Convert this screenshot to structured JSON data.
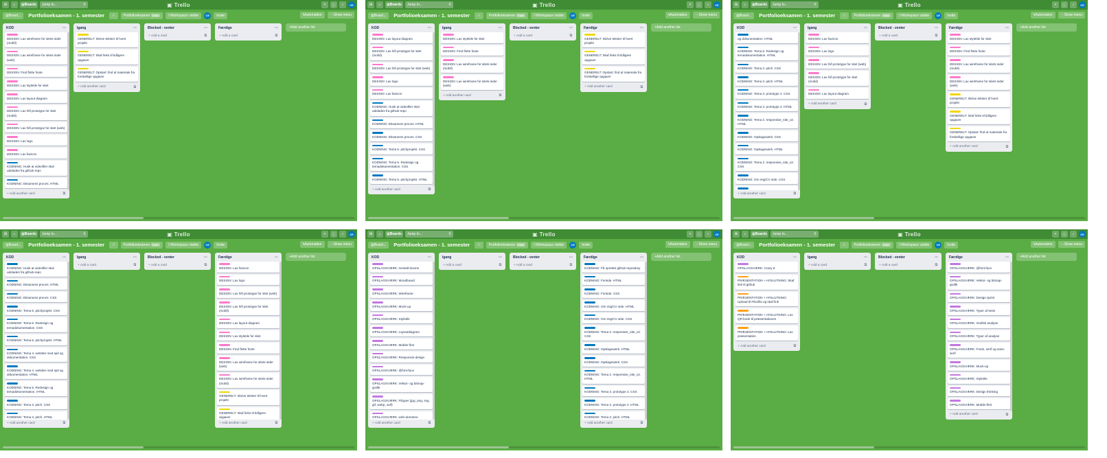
{
  "topbar": {
    "boards_label": "Boards",
    "search_placeholder": "Jump to...",
    "logo": "Trello",
    "avatar_initials": "CE"
  },
  "boardbar": {
    "view_label": "Board",
    "title": "Portfolioeksamen - 1. semester",
    "workspace_label": "Portfolioeksamen",
    "free_badge": "Free",
    "visibility_label": "Workspace visible",
    "invite_label": "Invite",
    "automation_label": "Automation",
    "show_menu_label": "Show menu"
  },
  "common": {
    "add_card": "Add another card",
    "add_card_short": "Add a card",
    "add_list": "Add another list",
    "list_menu": "···"
  },
  "colors": {
    "board_bg": "#5aac44",
    "topbar_bg": "#3f8c34",
    "DESIGN": "#ff78cb",
    "KODNING": "#0079bf",
    "GENERELT": "#f2d600",
    "OPSLAGSVÆRK": "#c377e0",
    "PRÆSENTATION": "#ff9f1a"
  },
  "screenshots": [
    {
      "lists": [
        {
          "title": "KOD",
          "has_scroll": true,
          "cards": [
            {
              "label": "DESIGN",
              "text": "DESIGN: Lav wireframe for sitets sider (mobil)"
            },
            {
              "label": "DESIGN",
              "text": "DESIGN: Lav wireframe for sitets sider (web)"
            },
            {
              "label": "DESIGN",
              "text": "DESIGN: Find flotte fonte"
            },
            {
              "label": "DESIGN",
              "text": "DESIGN: Lav styletile for sitet"
            },
            {
              "label": "DESIGN",
              "text": "DESIGN: Lav layout diagram"
            },
            {
              "label": "DESIGN",
              "text": "DESIGN: Lav hifi prototype for sitet (mobil)"
            },
            {
              "label": "DESIGN",
              "text": "DESIGN: Lav hifi prototype for sitet (web)"
            },
            {
              "label": "DESIGN",
              "text": "DESIGN: Lav logo"
            },
            {
              "label": "DESIGN",
              "text": "DESIGN: Lav favicon"
            },
            {
              "label": "KODNING",
              "text": "KODNING: Husk at videofiler skal udelades fra github-repo"
            },
            {
              "label": "KODNING",
              "text": "KODNING: Eksamens proces. HTML"
            }
          ],
          "add": "add_card"
        },
        {
          "title": "Igang",
          "cards": [
            {
              "label": "GENERELT",
              "text": "GENERELT: Skrive tekster til hvert projekt"
            },
            {
              "label": "GENERELT",
              "text": "GENERELT: Skaf links til tidligere opgaver"
            },
            {
              "label": "GENERELT",
              "text": "GENERELT: Opstart: find al materiale fra forskellige opgaver"
            }
          ],
          "add": "add_card"
        },
        {
          "title": "Blocked - venter",
          "cards": [],
          "add": "add_card_short"
        },
        {
          "title": "Færdige",
          "cards": [],
          "add": "add_card_short"
        }
      ]
    },
    {
      "lists": [
        {
          "title": "KOD",
          "has_scroll": true,
          "cards": [
            {
              "label": "DESIGN",
              "text": "DESIGN: Lav layout diagram"
            },
            {
              "label": "DESIGN",
              "text": "DESIGN: Lav hifi prototype for sitet (mobil)"
            },
            {
              "label": "DESIGN",
              "text": "DESIGN: Lav hifi prototype for sitet (web)"
            },
            {
              "label": "DESIGN",
              "text": "DESIGN: Lav logo"
            },
            {
              "label": "DESIGN",
              "text": "DESIGN: Lav favicon"
            },
            {
              "label": "KODNING",
              "text": "KODNING: Husk at videofiler skal udelades fra github-repo"
            },
            {
              "label": "KODNING",
              "text": "KODNING: Eksamens proces. HTML"
            },
            {
              "label": "KODNING",
              "text": "KODNING: Eksamens proces. CSS"
            },
            {
              "label": "KODNING",
              "text": "KODNING: Tema 5. pitchprojekt. CSS"
            },
            {
              "label": "KODNING",
              "text": "KODNING: Tema 5. Redesign og temadokumentation. CSS"
            },
            {
              "label": "KODNING",
              "text": "KODNING: Tema 5. pitchprojekt. HTML"
            }
          ],
          "add": "add_card"
        },
        {
          "title": "Igang",
          "cards": [
            {
              "label": "DESIGN",
              "text": "DESIGN: Lav styletile for sitet"
            },
            {
              "label": "DESIGN",
              "text": "DESIGN: Find flotte fonte"
            },
            {
              "label": "DESIGN",
              "text": "DESIGN: Lav wireframe for sitets sider (mobil)"
            },
            {
              "label": "DESIGN",
              "text": "DESIGN: Lav wireframe for sitets sider (web)"
            }
          ],
          "add": "add_card"
        },
        {
          "title": "Blocked - venter",
          "cards": [],
          "add": "add_card_short"
        },
        {
          "title": "Færdige",
          "cards": [
            {
              "label": "GENERELT",
              "text": "GENERELT: Skrive tekster til hvert projekt"
            },
            {
              "label": "GENERELT",
              "text": "GENERELT: Skaf links til tidligere opgaver"
            },
            {
              "label": "GENERELT",
              "text": "GENERELT: Opstart: find al materiale fra forskellige opgaver"
            }
          ],
          "add": "add_card"
        }
      ]
    },
    {
      "lists": [
        {
          "title": "KOD",
          "has_scroll": true,
          "cards": [
            {
              "label": "KODNING",
              "text": "og dokumentation. HTML"
            },
            {
              "label": "KODNING",
              "text": "KODNING: Tema 5. Redesign og temadokumentation. HTML"
            },
            {
              "label": "KODNING",
              "text": "KODNING: Tema 3. pitch. CSS"
            },
            {
              "label": "KODNING",
              "text": "KODNING: Tema 3. pitch. HTML"
            },
            {
              "label": "KODNING",
              "text": "KODNING: Tema 3. prototype 2. CSS"
            },
            {
              "label": "KODNING",
              "text": "KODNING: Tema 3. prototype 2. HTML"
            },
            {
              "label": "KODNING",
              "text": "KODNING: Tema 2. responsive_site_v2. HTML"
            },
            {
              "label": "KODNING",
              "text": "KODNING: Opslagsværk. CSS"
            },
            {
              "label": "KODNING",
              "text": "KODNING: Opslagsværk. HTML"
            },
            {
              "label": "KODNING",
              "text": "KODNING: Tema 2. responsive_site_v2. CSS"
            },
            {
              "label": "KODNING",
              "text": "KODNING: Om mig/CV side. CSS"
            },
            {
              "label": "KODNING",
              "text": "KODNING: Om mig/CV side. HTML"
            }
          ],
          "add": "add_card"
        },
        {
          "title": "Igang",
          "cards": [
            {
              "label": "DESIGN",
              "text": "DESIGN: Lav favicon"
            },
            {
              "label": "DESIGN",
              "text": "DESIGN: Lav logo"
            },
            {
              "label": "DESIGN",
              "text": "DESIGN: Lav hifi prototype for sitet (web)"
            },
            {
              "label": "DESIGN",
              "text": "DESIGN: Lav hifi prototype for sitet (mobil)"
            },
            {
              "label": "DESIGN",
              "text": "DESIGN: Lav layout diagram"
            }
          ],
          "add": "add_card"
        },
        {
          "title": "Blocked - venter",
          "cards": [],
          "add": "add_card_short"
        },
        {
          "title": "Færdige",
          "cards": [
            {
              "label": "DESIGN",
              "text": "DESIGN: Lav styletile for sitet"
            },
            {
              "label": "DESIGN",
              "text": "DESIGN: Find flotte fonte"
            },
            {
              "label": "DESIGN",
              "text": "DESIGN: Lav wireframe for sitets sider (mobil)"
            },
            {
              "label": "DESIGN",
              "text": "DESIGN: Lav wireframe for sitets sider (web)"
            },
            {
              "label": "GENERELT",
              "text": "GENERELT: Skrive tekster til hvert projekt"
            },
            {
              "label": "GENERELT",
              "text": "GENERELT: Skaf links til tidligere opgaver"
            },
            {
              "label": "GENERELT",
              "text": "GENERELT: Opstart: find al materiale fra forskellige opgaver"
            }
          ],
          "add": "add_card"
        }
      ]
    },
    {
      "lists": [
        {
          "title": "KOD",
          "has_scroll": true,
          "cards": [
            {
              "label": "KODNING",
              "text": "KODNING: Husk at videofiler skal udelades fra github-repo"
            },
            {
              "label": "KODNING",
              "text": "KODNING: Eksamens proces. HTML"
            },
            {
              "label": "KODNING",
              "text": "KODNING: Eksamens proces. CSS"
            },
            {
              "label": "KODNING",
              "text": "KODNING: Tema 5. pitchprojekt. CSS"
            },
            {
              "label": "KODNING",
              "text": "KODNING: Tema 5. Redesign og temadokumentation. CSS"
            },
            {
              "label": "KODNING",
              "text": "KODNING: Tema 5. pitchprojekt. HTML"
            },
            {
              "label": "KODNING",
              "text": "KODNING: Tema 4. website med spil og dokumentation. CSS"
            },
            {
              "label": "KODNING",
              "text": "KODNING: Tema 4. website med spil og dokumentation. HTML"
            },
            {
              "label": "KODNING",
              "text": "KODNING: Tema 5. Redesign og temadokumentation. HTML"
            },
            {
              "label": "KODNING",
              "text": "KODNING: Tema 3. pitch. CSS"
            },
            {
              "label": "KODNING",
              "text": "KODNING: Tema 3. pitch. HTML"
            }
          ],
          "add": "add_card"
        },
        {
          "title": "Igang",
          "cards": [],
          "add": "add_card_short"
        },
        {
          "title": "Blocked - venter",
          "cards": [],
          "add": "add_card_short"
        },
        {
          "title": "Færdige",
          "has_scroll": true,
          "cards": [
            {
              "label": "DESIGN",
              "text": "DESIGN: Lav favicon"
            },
            {
              "label": "DESIGN",
              "text": "DESIGN: Lav logo"
            },
            {
              "label": "DESIGN",
              "text": "DESIGN: Lav hifi prototype for sitet (web)"
            },
            {
              "label": "DESIGN",
              "text": "DESIGN: Lav hifi prototype for sitet (mobil)"
            },
            {
              "label": "DESIGN",
              "text": "DESIGN: Lav layout diagram"
            },
            {
              "label": "DESIGN",
              "text": "DESIGN: Lav styletile for sitet"
            },
            {
              "label": "DESIGN",
              "text": "DESIGN: Find flotte fonte"
            },
            {
              "label": "DESIGN",
              "text": "DESIGN: Lav wireframe for sitets sider (web)"
            },
            {
              "label": "DESIGN",
              "text": "DESIGN: Lav wireframe for sitets sider (mobil)"
            },
            {
              "label": "GENERELT",
              "text": "GENERELT: Skrive tekster til hvert projekt"
            },
            {
              "label": "GENERELT",
              "text": "GENERELT: Skaf links til tidligere opgaver"
            }
          ],
          "add": "add_card"
        }
      ]
    },
    {
      "lists": [
        {
          "title": "KOD",
          "has_scroll": true,
          "cards": [
            {
              "label": "OPSLAGSVÆRK",
              "text": "OPSLAGSVÆRK: Gestalt-lovene"
            },
            {
              "label": "OPSLAGSVÆRK",
              "text": "OPSLAGSVÆRK: Moodboard"
            },
            {
              "label": "OPSLAGSVÆRK",
              "text": "OPSLAGSVÆRK: Wireframe"
            },
            {
              "label": "OPSLAGSVÆRK",
              "text": "OPSLAGSVÆRK: Mock-up"
            },
            {
              "label": "OPSLAGSVÆRK",
              "text": "OPSLAGSVÆRK: Styletile"
            },
            {
              "label": "OPSLAGSVÆRK",
              "text": "OPSLAGSVÆRK: Layoutdiagram"
            },
            {
              "label": "OPSLAGSVÆRK",
              "text": "OPSLAGSVÆRK: Mobile-first"
            },
            {
              "label": "OPSLAGSVÆRK",
              "text": "OPSLAGSVÆRK: Responsivt design"
            },
            {
              "label": "OPSLAGSVÆRK",
              "text": "OPSLAGSVÆRK: @font-face"
            },
            {
              "label": "OPSLAGSVÆRK",
              "text": "OPSLAGSVÆRK: Vektor- og bitmap-grafik"
            },
            {
              "label": "OPSLAGSVÆRK",
              "text": "OPSLAGSVÆRK: Filtyper (jpg, png, svg, gif, webp, avif)"
            },
            {
              "label": "OPSLAGSVÆRK",
              "text": "OPSLAGSVÆRK: web-domæne"
            }
          ],
          "add": "add_card"
        },
        {
          "title": "Igang",
          "cards": [],
          "add": "add_card_short"
        },
        {
          "title": "Blocked - venter",
          "cards": [],
          "add": "add_card_short"
        },
        {
          "title": "Færdige",
          "has_scroll": true,
          "cards": [
            {
              "label": "KODNING",
              "text": "KODNING: Få oprettet github repository"
            },
            {
              "label": "KODNING",
              "text": "KODNING: Forside. HTML"
            },
            {
              "label": "KODNING",
              "text": "KODNING: Forside. CSS"
            },
            {
              "label": "KODNING",
              "text": "KODNING: Om mig/CV side. HTML"
            },
            {
              "label": "KODNING",
              "text": "KODNING: Om mig/CV side. CSS"
            },
            {
              "label": "KODNING",
              "text": "KODNING: Tema 2. responsive_site_v2. CSS"
            },
            {
              "label": "KODNING",
              "text": "KODNING: Opslagsværk. HTML"
            },
            {
              "label": "KODNING",
              "text": "KODNING: Opslagsværk. CSS"
            },
            {
              "label": "KODNING",
              "text": "KODNING: Tema 2. responsive_site_v2. HTML"
            },
            {
              "label": "KODNING",
              "text": "KODNING: Tema 3. prototype 2. CSS"
            },
            {
              "label": "KODNING",
              "text": "KODNING: Tema 3. prototype 2. HTML"
            },
            {
              "label": "KODNING",
              "text": "KODNING: Tema 3. pitch. HTML"
            }
          ],
          "add": "add_card"
        }
      ]
    },
    {
      "lists": [
        {
          "title": "KOD",
          "cards": [
            {
              "label": "OPSLAGSVÆRK",
              "text": "OPSLAGSVÆRK: Crazy 8"
            },
            {
              "label": "PRÆSENTATION",
              "text": "PRÆSENTATION + AFSLUTNING: Skaf link til github"
            },
            {
              "label": "PRÆSENTATION",
              "text": "PRÆSENTATION + AFSLUTNING: Upload til Filezilla og skaf link"
            },
            {
              "label": "PRÆSENTATION",
              "text": "PRÆSENTATION + AFSLUTNING: Lav QR-kode til præsentationen"
            },
            {
              "label": "PRÆSENTATION",
              "text": "PRÆSENTATION + AFSLUTNING: Lav præsentation"
            }
          ],
          "add": "add_card"
        },
        {
          "title": "Igang",
          "cards": [],
          "add": "add_card_short"
        },
        {
          "title": "Blocked - venter",
          "cards": [],
          "add": "add_card_short"
        },
        {
          "title": "Færdige",
          "has_scroll": true,
          "cards": [
            {
              "label": "OPSLAGSVÆRK",
              "text": "OPSLAGSVÆRK: @font-face"
            },
            {
              "label": "OPSLAGSVÆRK",
              "text": "OPSLAGSVÆRK: Vektor- og bitmap-grafik"
            },
            {
              "label": "OPSLAGSVÆRK",
              "text": "OPSLAGSVÆRK: Design sprint"
            },
            {
              "label": "OPSLAGSVÆRK",
              "text": "OPSLAGSVÆRK: Typer af tests"
            },
            {
              "label": "OPSLAGSVÆRK",
              "text": "OPSLAGSVÆRK: Grafisk analyse"
            },
            {
              "label": "OPSLAGSVÆRK",
              "text": "OPSLAGSVÆRK: Typer af analyse"
            },
            {
              "label": "OPSLAGSVÆRK",
              "text": "OPSLAGSVÆRK: Fonts, serif og sans-serif"
            },
            {
              "label": "OPSLAGSVÆRK",
              "text": "OPSLAGSVÆRK: Mock-up"
            },
            {
              "label": "OPSLAGSVÆRK",
              "text": "OPSLAGSVÆRK: Styletile"
            },
            {
              "label": "OPSLAGSVÆRK",
              "text": "OPSLAGSVÆRK: Design thinking"
            },
            {
              "label": "OPSLAGSVÆRK",
              "text": "OPSLAGSVÆRK: Mobile-first"
            }
          ],
          "add": "add_card"
        }
      ]
    }
  ]
}
